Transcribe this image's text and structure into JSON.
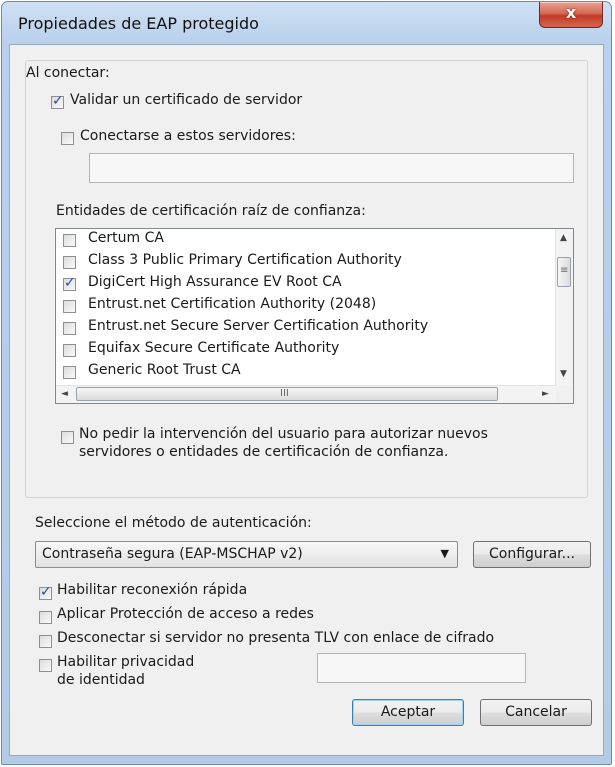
{
  "window": {
    "title": "Propiedades de EAP protegido",
    "close_glyph": "x"
  },
  "connect": {
    "header": "Al conectar:",
    "validate_cert": {
      "label": "Validar un certificado de servidor",
      "checked": true
    },
    "connect_servers": {
      "label": "Conectarse a estos servidores:",
      "checked": false,
      "value": ""
    },
    "trusted_roots_label": "Entidades de certificación raíz de confianza:",
    "trusted_roots": [
      {
        "label": "Certum CA",
        "checked": false
      },
      {
        "label": "Class 3 Public Primary Certification Authority",
        "checked": false
      },
      {
        "label": "DigiCert High Assurance EV Root CA",
        "checked": true
      },
      {
        "label": "Entrust.net Certification Authority (2048)",
        "checked": false
      },
      {
        "label": "Entrust.net Secure Server Certification Authority",
        "checked": false
      },
      {
        "label": "Equifax Secure Certificate Authority",
        "checked": false
      },
      {
        "label": "Generic Root Trust CA",
        "checked": false
      }
    ],
    "no_prompt": {
      "line1": "No pedir la intervención del usuario para autorizar nuevos",
      "line2": "servidores o entidades de certificación de confianza.",
      "checked": false
    }
  },
  "auth": {
    "label": "Seleccione el método de autenticación:",
    "selected": "Contraseña segura (EAP-MSCHAP v2)",
    "configure_label": "Configurar..."
  },
  "options": {
    "fast_reconnect": {
      "label": "Habilitar reconexión rápida",
      "checked": true
    },
    "nap": {
      "label": "Aplicar Protección de acceso a redes",
      "checked": false
    },
    "disconnect_tlv": {
      "label": "Desconectar si servidor no presenta TLV con enlace de cifrado",
      "checked": false
    },
    "identity_privacy": {
      "line1": "Habilitar privacidad",
      "line2": "de identidad",
      "checked": false,
      "value": ""
    }
  },
  "buttons": {
    "ok": "Aceptar",
    "cancel": "Cancelar"
  },
  "scrollbar": {
    "up": "▲",
    "down": "▼",
    "left": "◄",
    "right": "►",
    "grip_v": "≡",
    "grip_h": "III"
  }
}
